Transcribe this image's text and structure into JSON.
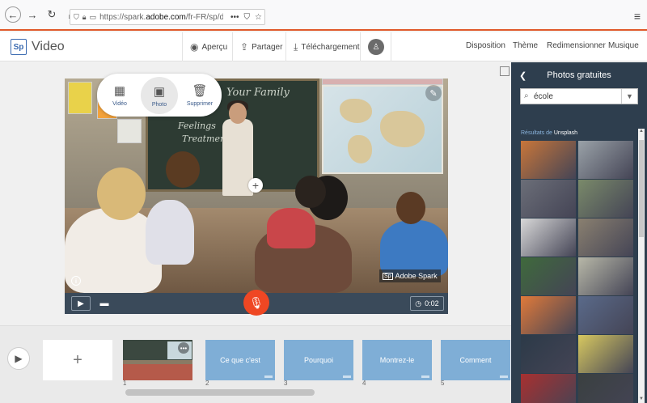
{
  "browser": {
    "url_prefix": "https://spark.",
    "url_domain": "adobe.com",
    "url_path": "/fr-FR/sp/des",
    "url_more": "•••"
  },
  "app": {
    "logo_badge": "Sp",
    "logo_text": "Video"
  },
  "header": {
    "preview": "Aperçu",
    "share": "Partager",
    "download": "Téléchargement",
    "layout": "Disposition",
    "theme": "Thème",
    "resize": "Redimensionner",
    "music": "Musique"
  },
  "popup": {
    "video": "Vidéo",
    "photo": "Photo",
    "delete": "Supprimer"
  },
  "slide_image": {
    "chalk_line1": "Your Family",
    "chalk_line2": "Feelings",
    "chalk_line3": "Treatment",
    "watermark_badge": "Sp",
    "watermark": "Adobe Spark"
  },
  "controls": {
    "time": "0:02"
  },
  "timeline": {
    "add": "+",
    "slides": [
      {
        "num": "1",
        "label": ""
      },
      {
        "num": "2",
        "label": "Ce que c'est"
      },
      {
        "num": "3",
        "label": "Pourquoi"
      },
      {
        "num": "4",
        "label": "Montrez-le"
      },
      {
        "num": "5",
        "label": "Comment"
      }
    ]
  },
  "panel": {
    "title": "Photos gratuites",
    "search_value": "école",
    "results_prefix": "Résultats de",
    "results_source": "Unsplash",
    "thumb_colors": [
      "#c8763a",
      "#9aa2a8",
      "#6b6e78",
      "#7a8a6a",
      "#d8d8d8",
      "#8a8070",
      "#3f6a3c",
      "#b8b8a8",
      "#e07a3a",
      "#5a6a8a",
      "#2c3a48",
      "#d7c860",
      "#a83030",
      "#3a4040"
    ]
  },
  "colors": {
    "accent": "#ef4723",
    "panel_bg": "#2e3e4e",
    "slide_blue": "#7faed6",
    "logo_blue": "#3a6ab0"
  }
}
